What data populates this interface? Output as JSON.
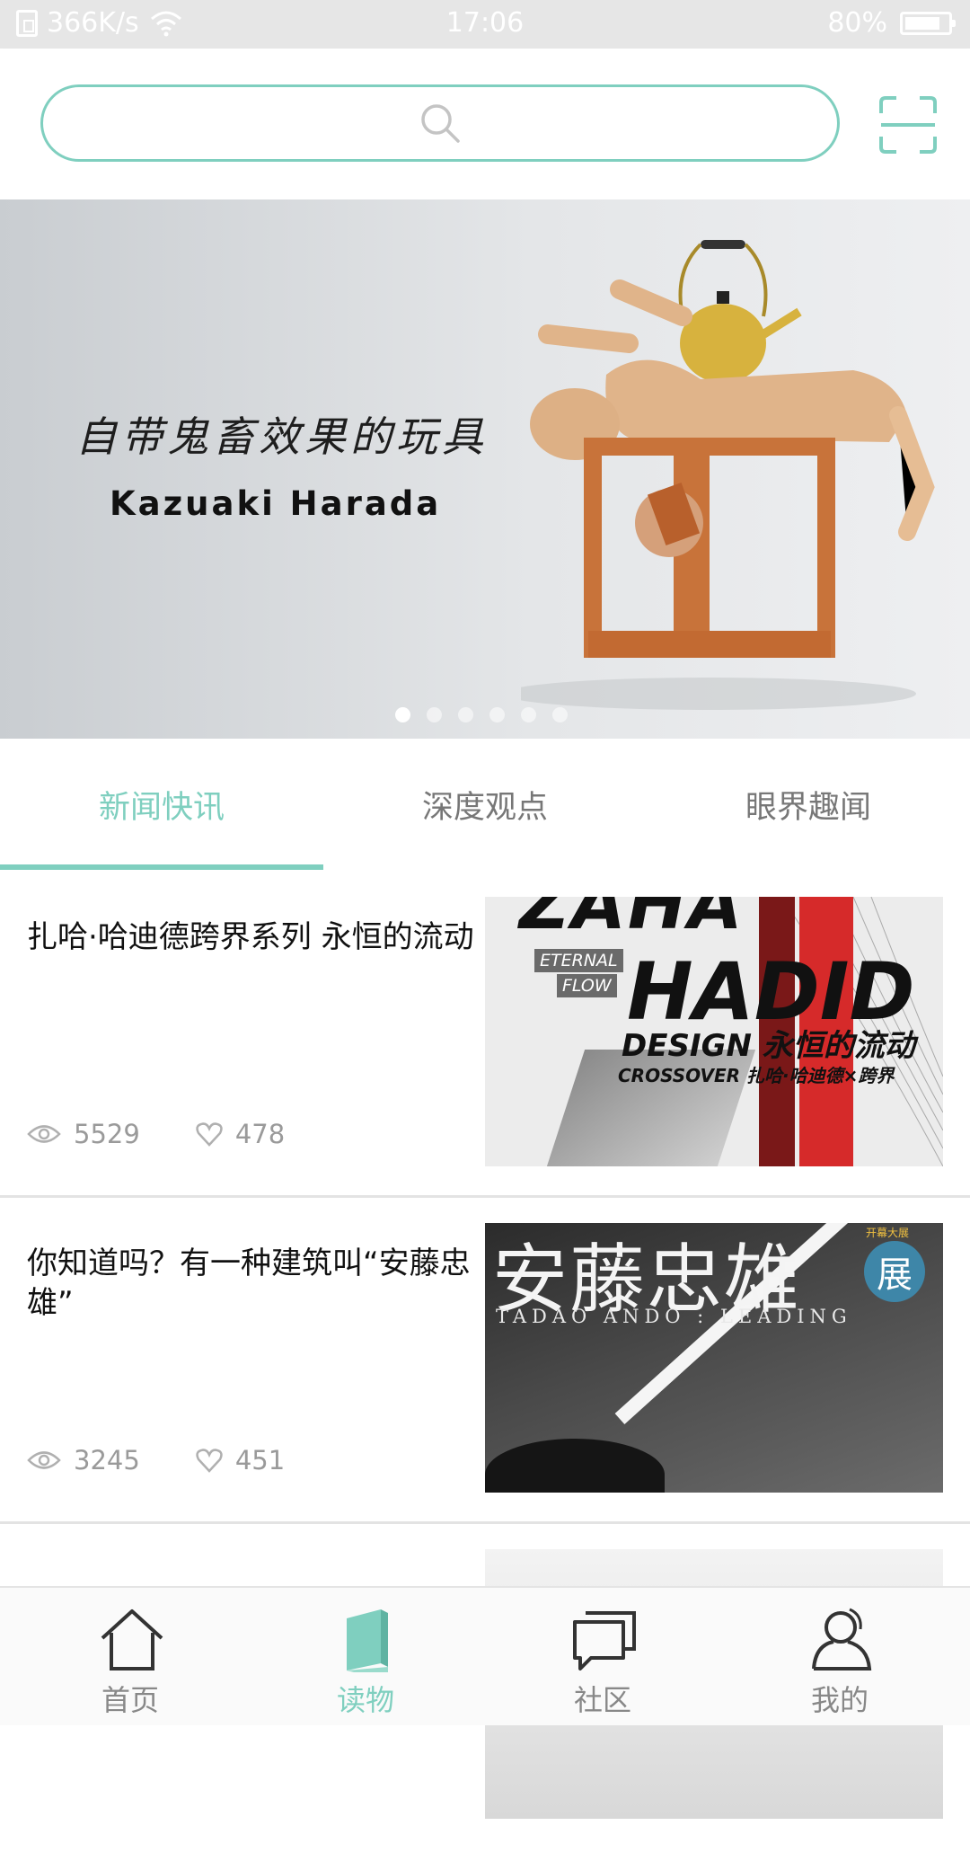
{
  "status_bar": {
    "speed": "366K/s",
    "time": "17:06",
    "battery": "80%"
  },
  "search": {
    "placeholder": ""
  },
  "banner": {
    "title_cn": "自带鬼畜效果的玩具",
    "title_en": "Kazuaki Harada",
    "dots_total": 6,
    "active_index": 0
  },
  "tabs": [
    {
      "label": "新闻快讯",
      "active": true
    },
    {
      "label": "深度观点",
      "active": false
    },
    {
      "label": "眼界趣闻",
      "active": false
    }
  ],
  "articles": [
    {
      "title": "扎哈·哈迪德跨界系列 永恒的流动",
      "views": "5529",
      "likes": "478",
      "thumb_text": {
        "zaha": "ZAHA",
        "eternal": "ETERNAL",
        "flow": "FLOW",
        "hadid": "HADID",
        "design": "DESIGN 永恒的流动",
        "crossover": "CROSSOVER 扎哈·哈迪德×跨界"
      }
    },
    {
      "title": "你知道吗？有一种建筑叫“安藤忠雄”",
      "views": "3245",
      "likes": "451",
      "thumb_text": {
        "cn": "安藤忠雄",
        "en": "TADAO ANDO : LEADING",
        "badge": "展",
        "badge_top": "开幕大展"
      }
    }
  ],
  "bottom_nav": [
    {
      "label": "首页",
      "icon": "home-icon",
      "active": false
    },
    {
      "label": "读物",
      "icon": "book-icon",
      "active": true
    },
    {
      "label": "社区",
      "icon": "chat-icon",
      "active": false
    },
    {
      "label": "我的",
      "icon": "user-icon",
      "active": false
    }
  ],
  "colors": {
    "accent": "#7fcfbf",
    "inactive": "#888888",
    "status_bar": "#e6e6e6"
  }
}
